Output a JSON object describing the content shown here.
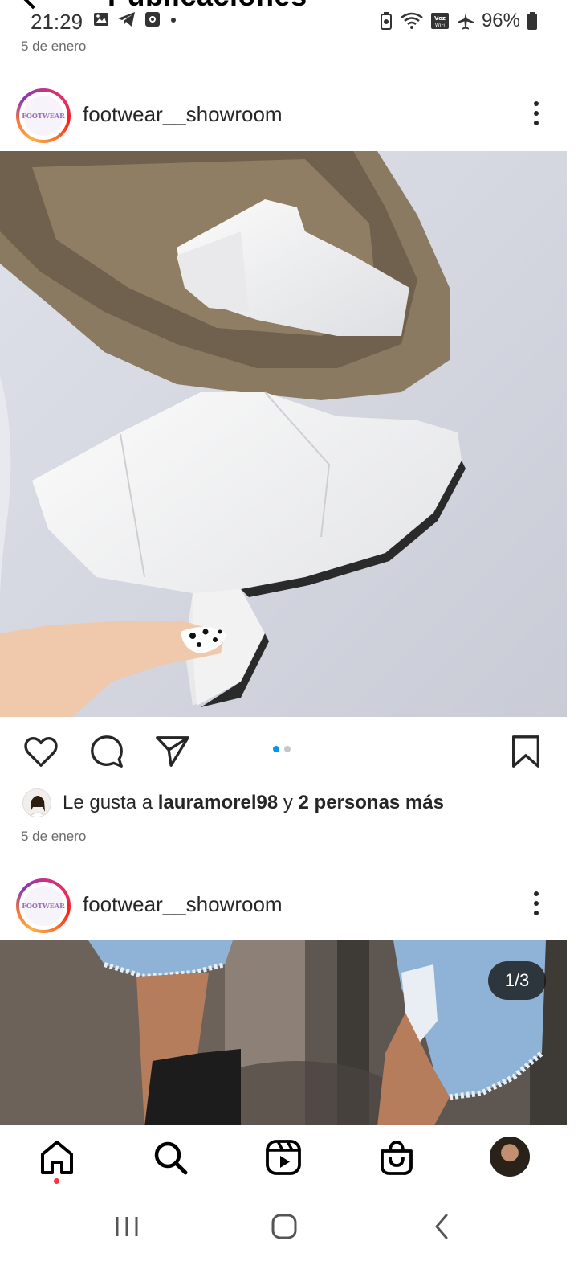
{
  "header": {
    "title": "Publicaciones"
  },
  "status_bar": {
    "time": "21:29",
    "battery": "96%"
  },
  "posts": [
    {
      "date": "5 de enero",
      "username": "footwear__showroom",
      "avatar_text": "FOOTWEAR",
      "carousel_pages": 2,
      "carousel_active": 1,
      "likes": {
        "prefix": "Le gusta a ",
        "user": "lauramorel98",
        "connector": " y ",
        "others": "2 personas más"
      },
      "footer_date": "5 de enero"
    },
    {
      "username": "footwear__showroom",
      "avatar_text": "FOOTWEAR",
      "counter": "1/3"
    }
  ],
  "actions": {
    "icons": [
      "heart-icon",
      "comment-icon",
      "share-icon",
      "bookmark-icon"
    ]
  },
  "bottom_nav": {
    "items": [
      "home-icon",
      "search-icon",
      "reels-icon",
      "shop-icon",
      "profile-avatar"
    ],
    "active": "home-icon",
    "notification_color": "#ff3040"
  },
  "system_nav": {
    "items": [
      "recents-button",
      "home-button",
      "back-button"
    ]
  },
  "colors": {
    "accent": "#0095f6",
    "text": "#262626",
    "muted": "#6b6b6b"
  }
}
